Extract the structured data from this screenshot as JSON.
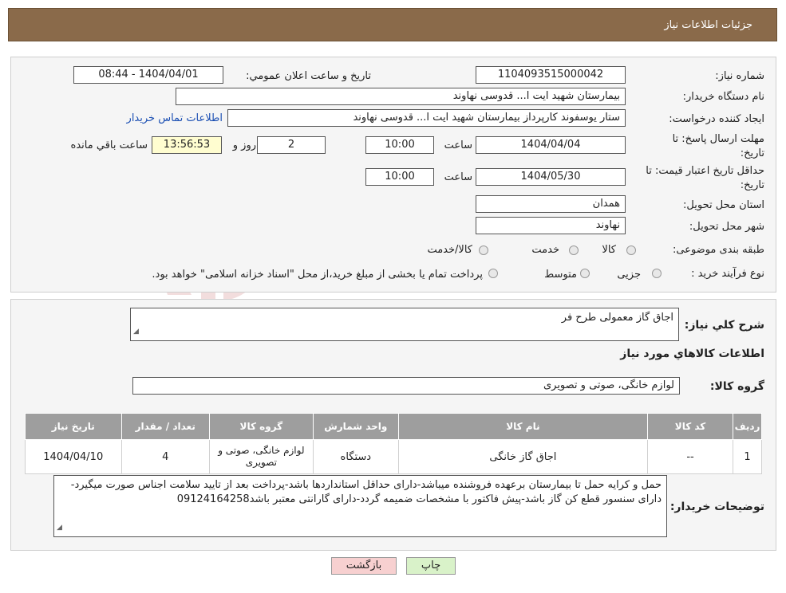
{
  "header": {
    "title": "جزئیات اطلاعات نیاز"
  },
  "form": {
    "need_number_label": "شماره نیاز:",
    "need_number": "1104093515000042",
    "announce_label": "تاریخ و ساعت اعلان عمومي:",
    "announce_value": "1404/04/01 - 08:44",
    "buyer_org_label": "نام دستگاه خريدار:",
    "buyer_org": "بیمارستان شهید ایت ا... قدوسی نهاوند",
    "creator_label": "ايجاد کننده درخواست:",
    "creator": "ستار یوسفوند کارپرداز بیمارستان شهید ایت ا... قدوسی نهاوند",
    "contact_link": "اطلاعات تماس خريدار",
    "reply_deadline_label": "مهلت ارسال پاسخ: تا تاریخ:",
    "reply_date": "1404/04/04",
    "time_label": "ساعت",
    "reply_time": "10:00",
    "days_value": "2",
    "days_label": "روز و",
    "remaining_time": "13:56:53",
    "remaining_label": "ساعت باقي مانده",
    "price_validity_label": "حداقل تاريخ اعتبار قيمت: تا تاریخ:",
    "price_date": "1404/05/30",
    "price_time": "10:00",
    "province_label": "استان محل تحويل:",
    "province": "همدان",
    "city_label": "شهر محل تحويل:",
    "city": "نهاوند",
    "category_label": "طبقه بندی موضوعی:",
    "category_options": [
      "کالا",
      "خدمت",
      "کالا/خدمت"
    ],
    "process_label": "نوع فرآيند خريد :",
    "process_options": [
      "جزیی",
      "متوسط"
    ],
    "process_note": "پرداخت تمام يا بخشی از مبلغ خريد،از محل \"اسناد خزانه اسلامی\" خواهد بود."
  },
  "summary": {
    "description_label": "شرح کلي نياز:",
    "description": "اجاق گاز معمولی طرح فر",
    "goods_info_title": "اطلاعات کالاهاي مورد نياز",
    "group_label": "گروه کالا:",
    "group_value": "لوازم خانگی، صوتی و تصویری"
  },
  "table": {
    "headers": [
      "رديف",
      "کد کالا",
      "نام کالا",
      "واحد شمارش",
      "گروه کالا",
      "تعداد / مقدار",
      "تاريخ نياز"
    ],
    "rows": [
      [
        "1",
        "--",
        "اجاق گاز خانگی",
        "دستگاه",
        "لوازم خانگی، صوتی و تصویری",
        "4",
        "1404/04/10"
      ]
    ]
  },
  "notes": {
    "label": "توضيحات خريدار:",
    "text": "حمل و کرایه حمل تا بیمارستان برعهده فروشنده میباشد-دارای حداقل استانداردها باشد-پرداخت بعد از تایید سلامت اجناس صورت میگیرد-دارای سنسور قطع کن گاز باشد-پیش فاکتور با مشخصات ضمیمه گردد-دارای گارانتی معتبر باشد09124164258"
  },
  "buttons": {
    "print": "چاپ",
    "back": "بازگشت"
  },
  "watermark": {
    "text": "AriaTender.neT"
  },
  "colors": {
    "header": "#8a6a4a",
    "table_header": "#9e9e9e",
    "link": "#1b4fb3",
    "back_button": "#f7d0d0",
    "print_button": "#d9f2c9"
  }
}
